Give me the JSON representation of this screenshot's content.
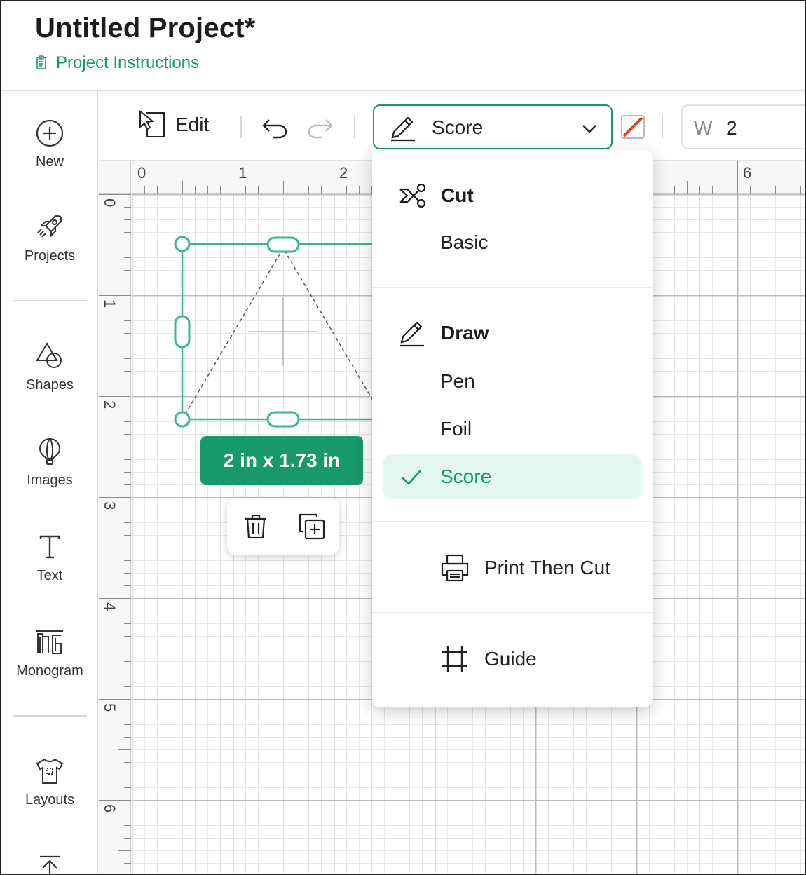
{
  "header": {
    "title": "Untitled Project*",
    "instructions_link": "Project Instructions"
  },
  "sidebar": {
    "items": [
      {
        "label": "New",
        "icon": "plus-circle-icon"
      },
      {
        "label": "Projects",
        "icon": "rocket-icon"
      },
      {
        "label": "Shapes",
        "icon": "shapes-icon"
      },
      {
        "label": "Images",
        "icon": "balloon-icon"
      },
      {
        "label": "Text",
        "icon": "text-icon"
      },
      {
        "label": "Monogram",
        "icon": "monogram-icon"
      },
      {
        "label": "Layouts",
        "icon": "tshirt-icon"
      }
    ]
  },
  "toolbar": {
    "edit_label": "Edit",
    "operation_value": "Score",
    "width_label": "W",
    "width_value": "2",
    "swatch_color": "#d9451f"
  },
  "rulers": {
    "top": [
      "0",
      "1",
      "2",
      "6"
    ],
    "left": [
      "0",
      "1",
      "2",
      "3",
      "4",
      "5",
      "6"
    ]
  },
  "selection": {
    "dimensions": "2  in x 1.73  in"
  },
  "operation_menu": {
    "groups": [
      {
        "heading": "Cut",
        "icon": "scissors-icon",
        "items": [
          "Basic"
        ]
      },
      {
        "heading": "Draw",
        "icon": "pen-icon",
        "items": [
          "Pen",
          "Foil",
          "Score"
        ]
      }
    ],
    "selected": "Score",
    "print_then_cut": "Print Then Cut",
    "guide": "Guide"
  },
  "colors": {
    "accent": "#17996a",
    "selected_bg": "#e3f6ef"
  }
}
